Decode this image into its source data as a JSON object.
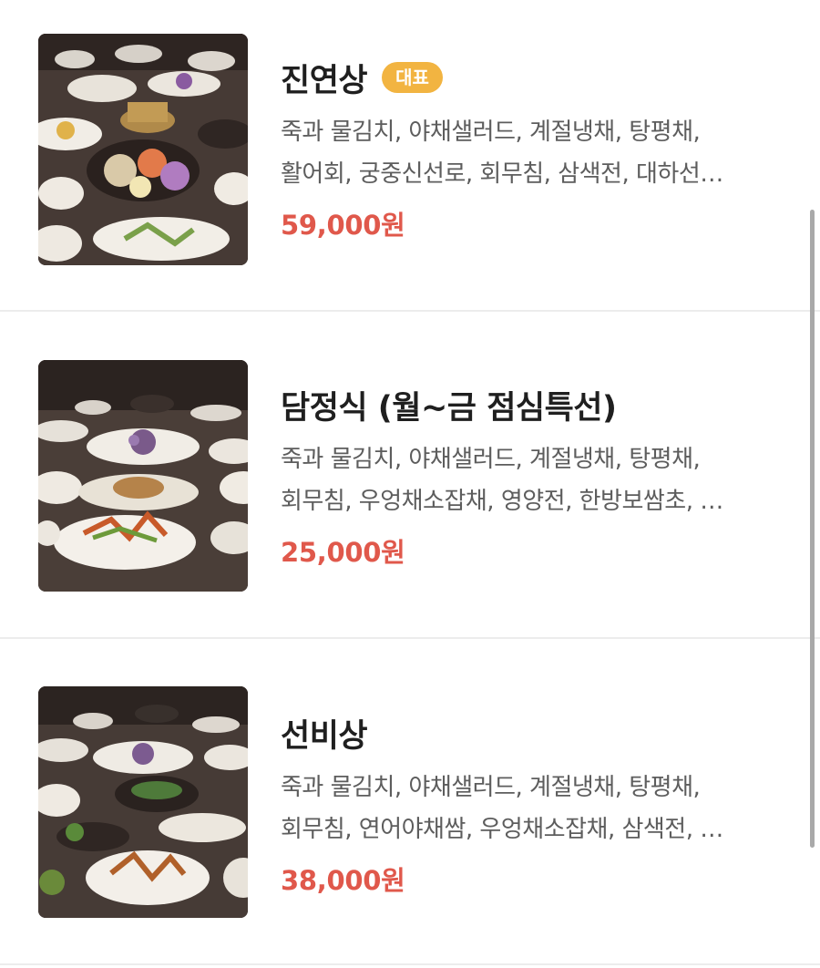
{
  "menus": [
    {
      "name": "진연상",
      "badge": "대표",
      "desc_line1": "죽과 물김치, 야채샐러드, 계절냉채, 탕평채,",
      "desc_line2": "활어회, 궁중신선로, 회무침, 삼색전, 대하선…",
      "price": "59,000원"
    },
    {
      "name": "담정식 (월~금 점심특선)",
      "badge": "",
      "desc_line1": "죽과 물김치, 야채샐러드, 계절냉채, 탕평채,",
      "desc_line2": "회무침, 우엉채소잡채, 영양전, 한방보쌈초, …",
      "price": "25,000원"
    },
    {
      "name": "선비상",
      "badge": "",
      "desc_line1": "죽과 물김치, 야채샐러드, 계절냉채, 탕평채,",
      "desc_line2": "회무침, 연어야채쌈, 우엉채소잡채, 삼색전, …",
      "price": "38,000원"
    }
  ],
  "colors": {
    "price": "#e0584b",
    "badge": "#f2b441",
    "title": "#1f1f1f",
    "desc": "#5d5d5d",
    "divider": "#ececec"
  }
}
